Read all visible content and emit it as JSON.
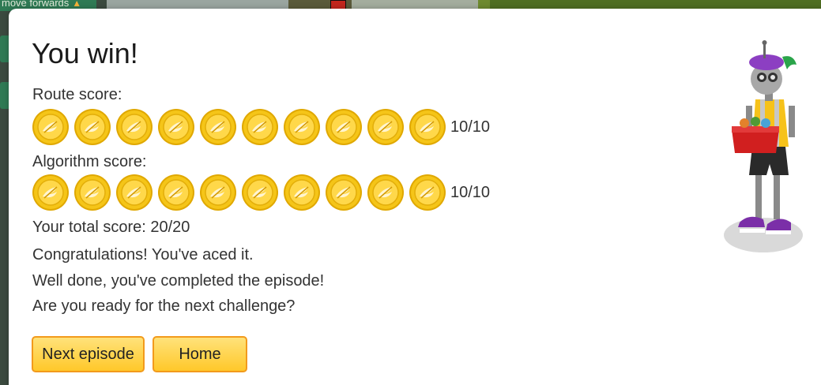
{
  "background": {
    "hint_text": "move forwards",
    "hint_icon": "arrow-up-icon"
  },
  "modal": {
    "title": "You win!",
    "route_label": "Route score:",
    "route_coins": 10,
    "route_score": "10/10",
    "algorithm_label": "Algorithm score:",
    "algorithm_coins": 10,
    "algorithm_score": "10/10",
    "total_score": "Your total score: 20/20",
    "message_1": "Congratulations! You've aced it.",
    "message_2": "Well done, you've completed the episode!",
    "message_3": "Are you ready for the next challenge?",
    "next_button": "Next episode",
    "home_button": "Home",
    "coin_icon": "gold-coin-icon",
    "character_icon": "robot-van-driver-icon"
  },
  "colors": {
    "button_fill": "#ffd23f",
    "button_border": "#f29a1c",
    "coin_gold": "#f5c518"
  }
}
